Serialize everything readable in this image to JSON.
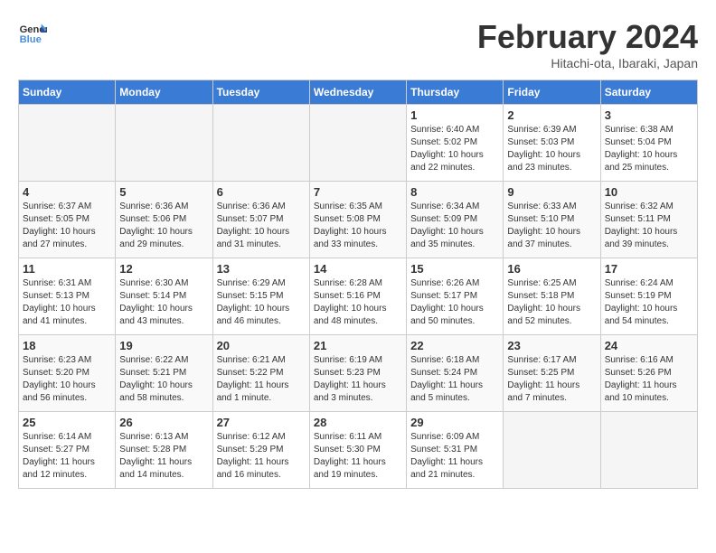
{
  "header": {
    "logo_general": "General",
    "logo_blue": "Blue",
    "title": "February 2024",
    "subtitle": "Hitachi-ota, Ibaraki, Japan"
  },
  "calendar": {
    "weekdays": [
      "Sunday",
      "Monday",
      "Tuesday",
      "Wednesday",
      "Thursday",
      "Friday",
      "Saturday"
    ],
    "weeks": [
      [
        {
          "day": "",
          "info": ""
        },
        {
          "day": "",
          "info": ""
        },
        {
          "day": "",
          "info": ""
        },
        {
          "day": "",
          "info": ""
        },
        {
          "day": "1",
          "info": "Sunrise: 6:40 AM\nSunset: 5:02 PM\nDaylight: 10 hours and 22 minutes."
        },
        {
          "day": "2",
          "info": "Sunrise: 6:39 AM\nSunset: 5:03 PM\nDaylight: 10 hours and 23 minutes."
        },
        {
          "day": "3",
          "info": "Sunrise: 6:38 AM\nSunset: 5:04 PM\nDaylight: 10 hours and 25 minutes."
        }
      ],
      [
        {
          "day": "4",
          "info": "Sunrise: 6:37 AM\nSunset: 5:05 PM\nDaylight: 10 hours and 27 minutes."
        },
        {
          "day": "5",
          "info": "Sunrise: 6:36 AM\nSunset: 5:06 PM\nDaylight: 10 hours and 29 minutes."
        },
        {
          "day": "6",
          "info": "Sunrise: 6:36 AM\nSunset: 5:07 PM\nDaylight: 10 hours and 31 minutes."
        },
        {
          "day": "7",
          "info": "Sunrise: 6:35 AM\nSunset: 5:08 PM\nDaylight: 10 hours and 33 minutes."
        },
        {
          "day": "8",
          "info": "Sunrise: 6:34 AM\nSunset: 5:09 PM\nDaylight: 10 hours and 35 minutes."
        },
        {
          "day": "9",
          "info": "Sunrise: 6:33 AM\nSunset: 5:10 PM\nDaylight: 10 hours and 37 minutes."
        },
        {
          "day": "10",
          "info": "Sunrise: 6:32 AM\nSunset: 5:11 PM\nDaylight: 10 hours and 39 minutes."
        }
      ],
      [
        {
          "day": "11",
          "info": "Sunrise: 6:31 AM\nSunset: 5:13 PM\nDaylight: 10 hours and 41 minutes."
        },
        {
          "day": "12",
          "info": "Sunrise: 6:30 AM\nSunset: 5:14 PM\nDaylight: 10 hours and 43 minutes."
        },
        {
          "day": "13",
          "info": "Sunrise: 6:29 AM\nSunset: 5:15 PM\nDaylight: 10 hours and 46 minutes."
        },
        {
          "day": "14",
          "info": "Sunrise: 6:28 AM\nSunset: 5:16 PM\nDaylight: 10 hours and 48 minutes."
        },
        {
          "day": "15",
          "info": "Sunrise: 6:26 AM\nSunset: 5:17 PM\nDaylight: 10 hours and 50 minutes."
        },
        {
          "day": "16",
          "info": "Sunrise: 6:25 AM\nSunset: 5:18 PM\nDaylight: 10 hours and 52 minutes."
        },
        {
          "day": "17",
          "info": "Sunrise: 6:24 AM\nSunset: 5:19 PM\nDaylight: 10 hours and 54 minutes."
        }
      ],
      [
        {
          "day": "18",
          "info": "Sunrise: 6:23 AM\nSunset: 5:20 PM\nDaylight: 10 hours and 56 minutes."
        },
        {
          "day": "19",
          "info": "Sunrise: 6:22 AM\nSunset: 5:21 PM\nDaylight: 10 hours and 58 minutes."
        },
        {
          "day": "20",
          "info": "Sunrise: 6:21 AM\nSunset: 5:22 PM\nDaylight: 11 hours and 1 minute."
        },
        {
          "day": "21",
          "info": "Sunrise: 6:19 AM\nSunset: 5:23 PM\nDaylight: 11 hours and 3 minutes."
        },
        {
          "day": "22",
          "info": "Sunrise: 6:18 AM\nSunset: 5:24 PM\nDaylight: 11 hours and 5 minutes."
        },
        {
          "day": "23",
          "info": "Sunrise: 6:17 AM\nSunset: 5:25 PM\nDaylight: 11 hours and 7 minutes."
        },
        {
          "day": "24",
          "info": "Sunrise: 6:16 AM\nSunset: 5:26 PM\nDaylight: 11 hours and 10 minutes."
        }
      ],
      [
        {
          "day": "25",
          "info": "Sunrise: 6:14 AM\nSunset: 5:27 PM\nDaylight: 11 hours and 12 minutes."
        },
        {
          "day": "26",
          "info": "Sunrise: 6:13 AM\nSunset: 5:28 PM\nDaylight: 11 hours and 14 minutes."
        },
        {
          "day": "27",
          "info": "Sunrise: 6:12 AM\nSunset: 5:29 PM\nDaylight: 11 hours and 16 minutes."
        },
        {
          "day": "28",
          "info": "Sunrise: 6:11 AM\nSunset: 5:30 PM\nDaylight: 11 hours and 19 minutes."
        },
        {
          "day": "29",
          "info": "Sunrise: 6:09 AM\nSunset: 5:31 PM\nDaylight: 11 hours and 21 minutes."
        },
        {
          "day": "",
          "info": ""
        },
        {
          "day": "",
          "info": ""
        }
      ]
    ]
  }
}
